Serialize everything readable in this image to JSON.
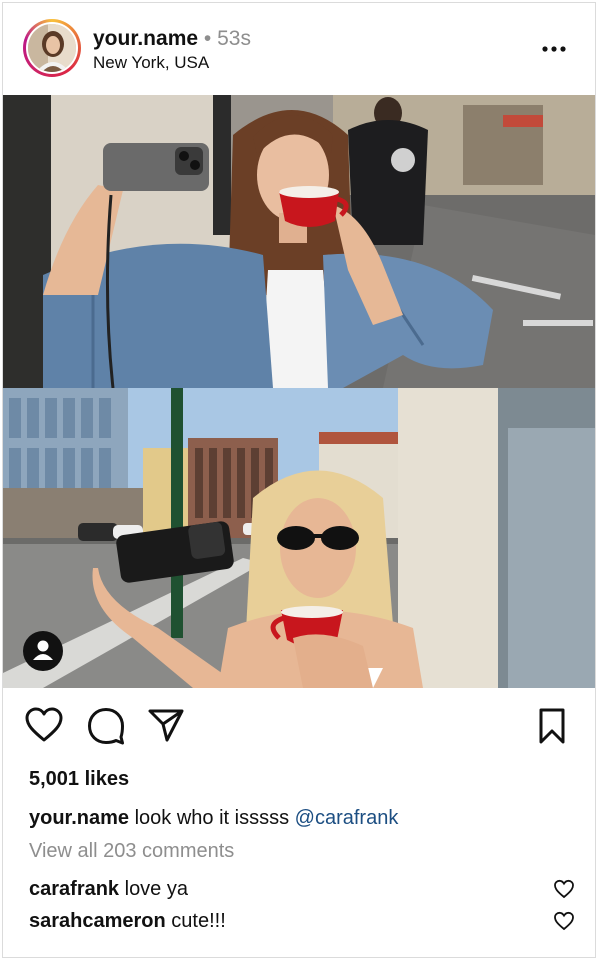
{
  "header": {
    "username": "your.name",
    "separator": "•",
    "time": "53s",
    "location": "New York, USA"
  },
  "icons": {
    "more": "more-options-icon",
    "like": "heart-icon",
    "comment": "comment-icon",
    "share": "send-icon",
    "save": "bookmark-icon",
    "tag": "user-tag-icon"
  },
  "stats": {
    "likes": "5,001 likes"
  },
  "caption": {
    "username": "your.name",
    "text": " look who it isssss ",
    "mention": "@carafrank"
  },
  "view_all": "View all 203 comments",
  "comments": [
    {
      "username": "carafrank",
      "text": " love ya"
    },
    {
      "username": "sarahcameron",
      "text": " cute!!!"
    }
  ],
  "colors": {
    "mention": "#1c4e82",
    "muted": "#8e8e8e",
    "cup": "#c8161d",
    "denim": "#5f82a8"
  }
}
